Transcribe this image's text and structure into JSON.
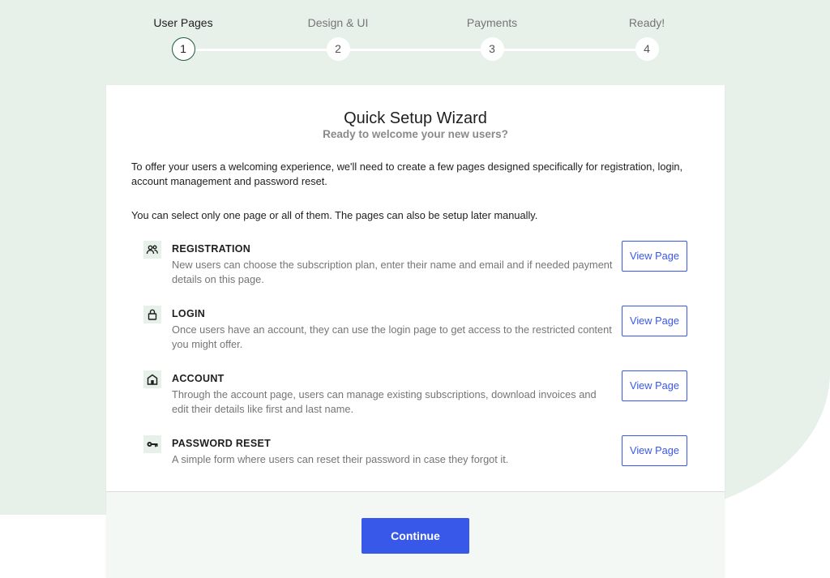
{
  "stepper": {
    "steps": [
      {
        "label": "User Pages",
        "number": "1"
      },
      {
        "label": "Design & UI",
        "number": "2"
      },
      {
        "label": "Payments",
        "number": "3"
      },
      {
        "label": "Ready!",
        "number": "4"
      }
    ],
    "active_step": 1
  },
  "wizard": {
    "title": "Quick Setup Wizard",
    "subtitle": "Ready to welcome your new users?",
    "intro": "To offer your users a welcoming experience, we'll need to create a few pages designed specifically for registration, login, account management and password reset.",
    "intro2": "You can select only one page or all of them. The pages can also be setup later manually.",
    "pages": [
      {
        "icon": "users-icon",
        "title": "REGISTRATION",
        "description": "New users can choose the subscription plan, enter their name and email and if needed payment details on this page.",
        "button_label": "View Page"
      },
      {
        "icon": "lock-icon",
        "title": "LOGIN",
        "description": "Once users have an account, they can use the login page to get access to the restricted content you might offer.",
        "button_label": "View Page"
      },
      {
        "icon": "home-icon",
        "title": "ACCOUNT",
        "description": "Through the account page, users can manage existing subscriptions, download invoices and edit their details like first and last name.",
        "button_label": "View Page"
      },
      {
        "icon": "key-icon",
        "title": "PASSWORD RESET",
        "description": "A simple form where users can reset their password in case they forgot it.",
        "button_label": "View Page"
      }
    ],
    "continue_label": "Continue"
  },
  "colors": {
    "accent": "#3858e9",
    "background_tint": "#e8f0ea",
    "active_step_border": "#1f5c3d",
    "footer_bg": "#f4f8f5"
  }
}
